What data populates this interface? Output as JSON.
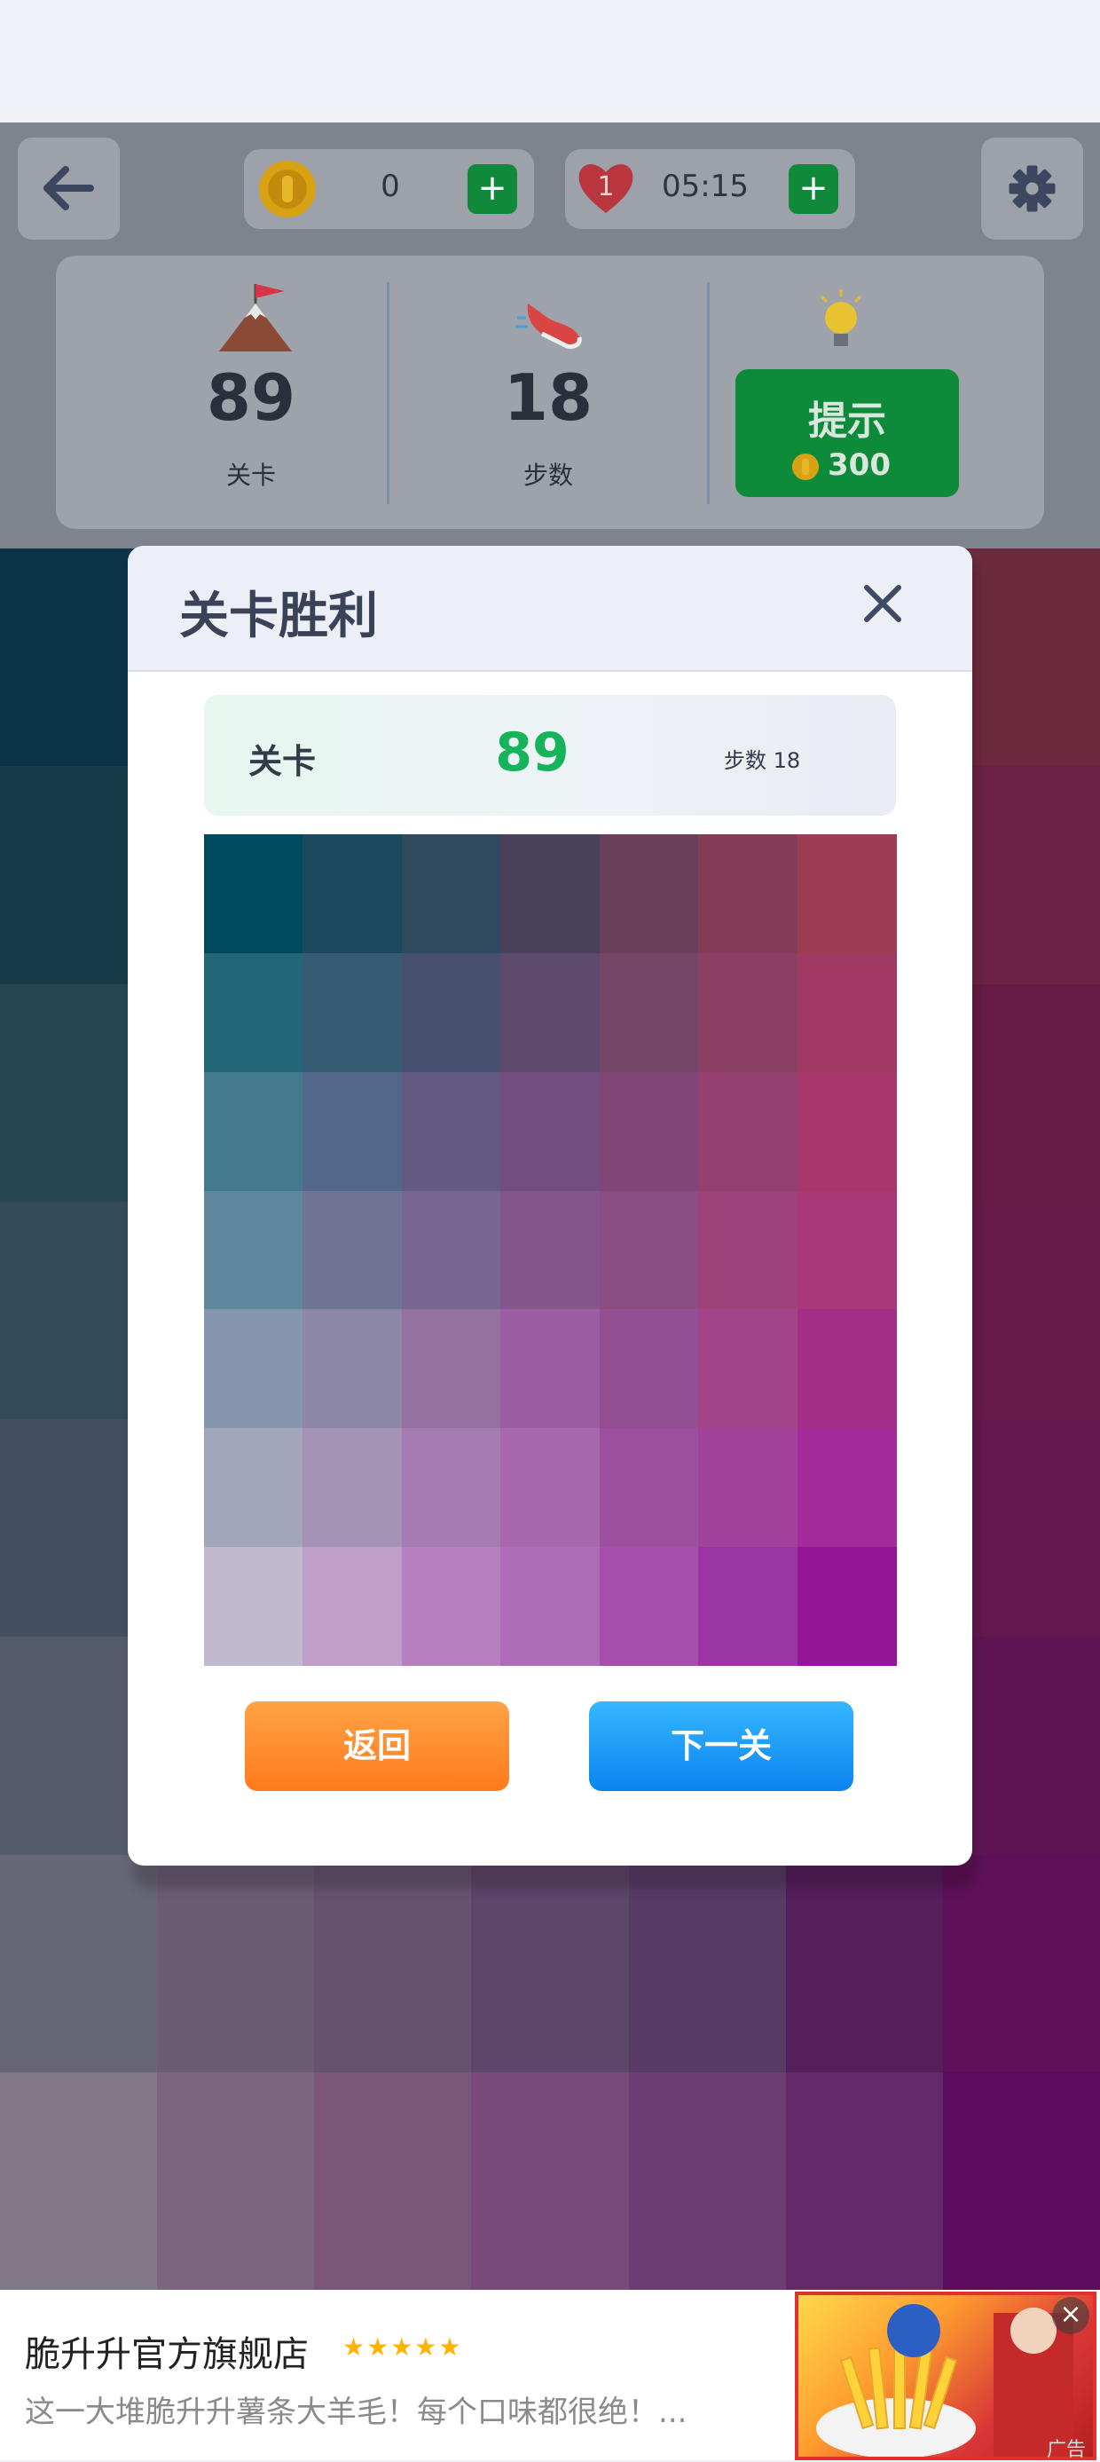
{
  "header": {
    "coins": "0",
    "plus_label": "+",
    "lives": "1",
    "timer": "05:15"
  },
  "stats": {
    "level_value": "89",
    "level_label": "关卡",
    "steps_value": "18",
    "steps_label": "步数",
    "hint_label": "提示",
    "hint_cost": "300"
  },
  "modal": {
    "title": "关卡胜利",
    "level_label": "关卡",
    "level_value": "89",
    "steps_text": "步数 18",
    "back_button": "返回",
    "next_button": "下一关"
  },
  "grid_colors": [
    [
      "#004a5f",
      "#1b4a5f",
      "#2f4a5f",
      "#4a425a",
      "#6a3f5a",
      "#843d58",
      "#9c3d55"
    ],
    [
      "#236677",
      "#365b73",
      "#485070",
      "#5e4a6c",
      "#744769",
      "#8a3f63",
      "#a03a62"
    ],
    [
      "#447a8d",
      "#53678a",
      "#625a82",
      "#724d7f",
      "#824578",
      "#943f71",
      "#a7376b"
    ],
    [
      "#5f889e",
      "#6f7495",
      "#796690",
      "#85568b",
      "#8c4c84",
      "#9c437c",
      "#a93878"
    ],
    [
      "#8696ae",
      "#8c87a7",
      "#93729f",
      "#9c5da3",
      "#934f91",
      "#a24487",
      "#a23088"
    ],
    [
      "#a1a6bc",
      "#a493b5",
      "#a47cb1",
      "#a767ae",
      "#9d50a0",
      "#a0419b",
      "#a12c9a"
    ],
    [
      "#c1bace",
      "#bf9fc7",
      "#b580bd",
      "#ad6bb8",
      "#a64faa",
      "#9a36a4",
      "#941697"
    ]
  ],
  "background_grid": [
    [
      "#0a3546",
      "#c0c0c0",
      "#c0c0c0",
      "#c0c0c0",
      "#c0c0c0",
      "#c0c0c0",
      "#6c2a3e"
    ],
    [
      "#173b4b",
      "#c0c0c0",
      "#c0c0c0",
      "#c0c0c0",
      "#c0c0c0",
      "#c0c0c0",
      "#6b2244"
    ],
    [
      "#264652",
      "#c0c0c0",
      "#c0c0c0",
      "#c0c0c0",
      "#c0c0c0",
      "#c0c0c0",
      "#661c46"
    ],
    [
      "#334b5a",
      "#c0c0c0",
      "#c0c0c0",
      "#c0c0c0",
      "#c0c0c0",
      "#c0c0c0",
      "#661b4a"
    ],
    [
      "#434f60",
      "#c0c0c0",
      "#c0c0c0",
      "#c0c0c0",
      "#c0c0c0",
      "#c0c0c0",
      "#641850"
    ],
    [
      "#545c6c",
      "#c0c0c0",
      "#c0c0c0",
      "#c0c0c0",
      "#c0c0c0",
      "#c0c0c0",
      "#5f1554"
    ],
    [
      "#676675",
      "#6a5c74",
      "#665270",
      "#5e456a",
      "#583b65",
      "#551f5c",
      "#5e1158"
    ],
    [
      "#807887",
      "#7c6580",
      "#7a567a",
      "#774a79",
      "#6b3d73",
      "#64296b",
      "#5c0c5e"
    ]
  ],
  "ad": {
    "title": "脆升升官方旗舰店",
    "stars": "★★★★★",
    "description": "这一大堆脆升升薯条大羊毛！每个口味都很绝！...",
    "close": "×",
    "label": "广告"
  },
  "icons": {
    "back": "arrow-left-icon",
    "settings": "gear-icon",
    "coin": "coin-icon",
    "heart": "heart-icon",
    "flag": "mountain-flag-icon",
    "shoe": "sneaker-icon",
    "bulb": "lightbulb-icon",
    "close": "close-icon"
  },
  "colors": {
    "green": "#0e8a3b",
    "level_green": "#16b45a",
    "orange": "#ff8a26",
    "blue": "#1a96f5"
  }
}
